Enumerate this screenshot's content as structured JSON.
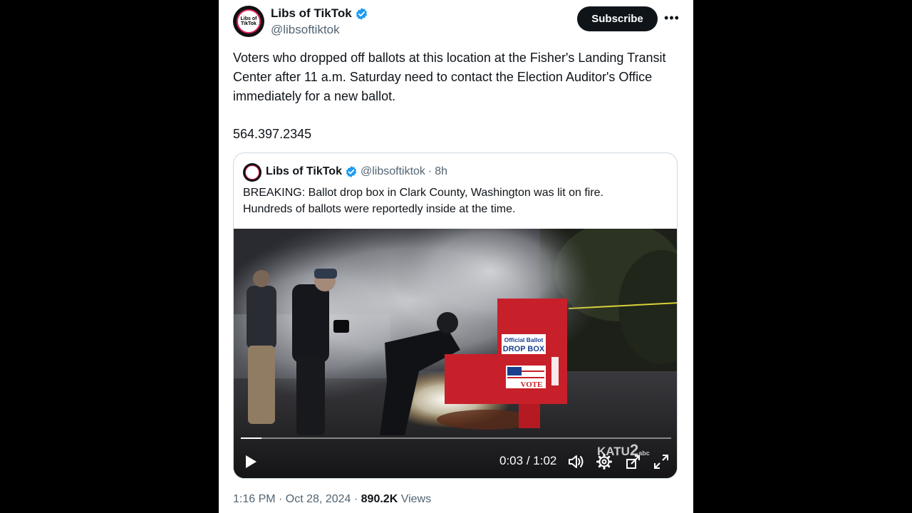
{
  "post": {
    "author_name": "Libs of TikTok",
    "author_handle": "@libsoftiktok",
    "avatar_text": "Libs of TikTok",
    "subscribe_label": "Subscribe",
    "more_label": "•••",
    "text": "Voters who dropped off ballots at this location at the Fisher's Landing Transit Center after 11 a.m. Saturday need to contact the Election Auditor's Office immediately for a new ballot.",
    "phone": "564.397.2345",
    "timestamp": "1:16 PM · Oct 28, 2024",
    "meta_sep": "·",
    "views_count": "890.2K",
    "views_label": "Views"
  },
  "quote": {
    "author_name": "Libs of TikTok",
    "author_handle": "@libsoftiktok",
    "separator": "·",
    "time_ago": "8h",
    "text_line1": "BREAKING: Ballot drop box in Clark County, Washington was lit on fire.",
    "text_line2": "Hundreds of ballots were reportedly inside at the time."
  },
  "video": {
    "current_time": "0:03",
    "duration": "1:02",
    "time_sep": " / ",
    "progress": 0.048,
    "box_sign_line1": "Official Ballot",
    "box_sign_line2": "DROP BOX",
    "box_vote_label": "VOTE",
    "watermark": "KATU",
    "watermark_num": "2",
    "watermark_net": "abc",
    "icons": [
      "play-icon",
      "volume-icon",
      "settings-icon",
      "pip-icon",
      "fullscreen-icon"
    ]
  },
  "colors": {
    "brand_verified": "#1d9bf0",
    "text_primary": "#0f1419",
    "text_secondary": "#536471",
    "button_dark": "#0f1419",
    "dropbox_red": "#c8202a"
  }
}
